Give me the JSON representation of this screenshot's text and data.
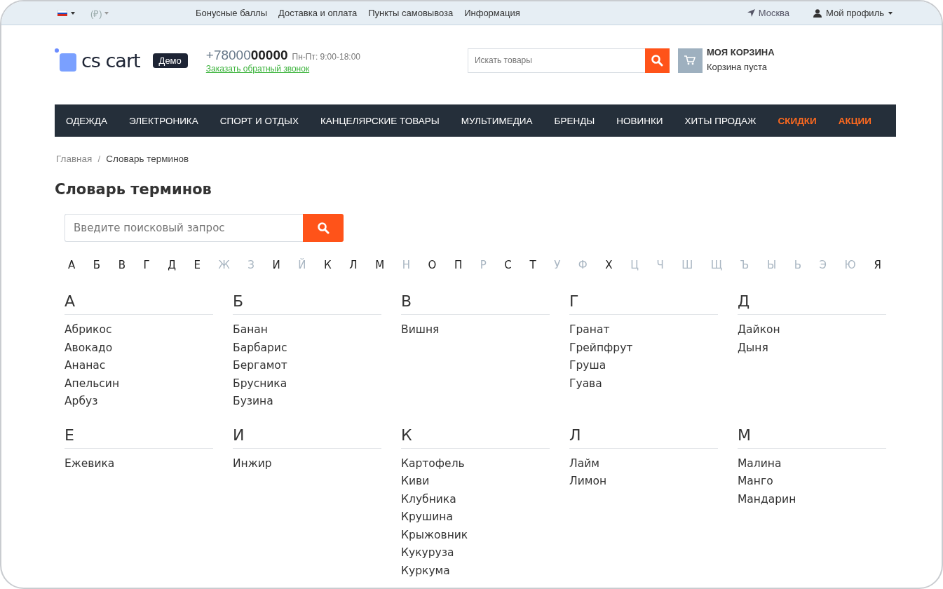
{
  "top_bar": {
    "language_flag": true,
    "currency": "(₽)",
    "links": [
      "Бонусные баллы",
      "Доставка и оплата",
      "Пункты самовывоза",
      "Информация"
    ],
    "city": "Москва",
    "profile": "Мой профиль"
  },
  "header": {
    "logo": "cs cart",
    "badge": "Демо",
    "phone": "+78000**00000**",
    "hours": "Пн-Пт: 9:00-18:00",
    "callback": "Заказать обратный звонок",
    "search": {
      "placeholder": "Искать товары"
    },
    "cart": {
      "title": "МОЯ КОРЗИНА",
      "status": "Корзина пуста"
    }
  },
  "menu": [
    {
      "label": "ОДЕЖДА",
      "highlight": false
    },
    {
      "label": "ЭЛЕКТРОНИКА",
      "highlight": false
    },
    {
      "label": "СПОРТ И ОТДЫХ",
      "highlight": false
    },
    {
      "label": "КАНЦЕЛЯРСКИЕ ТОВАРЫ",
      "highlight": false
    },
    {
      "label": "МУЛЬТИМЕДИА",
      "highlight": false
    },
    {
      "label": "БРЕНДЫ",
      "highlight": false
    },
    {
      "label": "НОВИНКИ",
      "highlight": false
    },
    {
      "label": "ХИТЫ ПРОДАЖ",
      "highlight": false
    },
    {
      "label": "СКИДКИ",
      "highlight": true
    },
    {
      "label": "АКЦИИ",
      "highlight": true
    }
  ],
  "breadcrumbs": [
    "Главная",
    "Словарь терминов"
  ],
  "breadcrumb_separator": "/",
  "page_title": "Словарь терминов",
  "glossary_search": {
    "placeholder": "Введите поисковый запрос"
  },
  "alphabet": [
    {
      "letter": "А",
      "disabled": false
    },
    {
      "letter": "Б",
      "disabled": false
    },
    {
      "letter": "В",
      "disabled": false
    },
    {
      "letter": "Г",
      "disabled": false
    },
    {
      "letter": "Д",
      "disabled": false
    },
    {
      "letter": "Е",
      "disabled": false
    },
    {
      "letter": "Ж",
      "disabled": true
    },
    {
      "letter": "З",
      "disabled": true
    },
    {
      "letter": "И",
      "disabled": false
    },
    {
      "letter": "Й",
      "disabled": true
    },
    {
      "letter": "К",
      "disabled": false
    },
    {
      "letter": "Л",
      "disabled": false
    },
    {
      "letter": "М",
      "disabled": false
    },
    {
      "letter": "Н",
      "disabled": true
    },
    {
      "letter": "О",
      "disabled": false
    },
    {
      "letter": "П",
      "disabled": false
    },
    {
      "letter": "Р",
      "disabled": true
    },
    {
      "letter": "С",
      "disabled": false
    },
    {
      "letter": "Т",
      "disabled": false
    },
    {
      "letter": "У",
      "disabled": true
    },
    {
      "letter": "Ф",
      "disabled": true
    },
    {
      "letter": "Х",
      "disabled": false
    },
    {
      "letter": "Ц",
      "disabled": true
    },
    {
      "letter": "Ч",
      "disabled": true
    },
    {
      "letter": "Ш",
      "disabled": true
    },
    {
      "letter": "Щ",
      "disabled": true
    },
    {
      "letter": "Ъ",
      "disabled": true
    },
    {
      "letter": "Ы",
      "disabled": true
    },
    {
      "letter": "Ь",
      "disabled": true
    },
    {
      "letter": "Э",
      "disabled": true
    },
    {
      "letter": "Ю",
      "disabled": true
    },
    {
      "letter": "Я",
      "disabled": false
    }
  ],
  "groups": [
    {
      "letter": "А",
      "terms": [
        "Абрикос",
        "Авокадо",
        "Ананас",
        "Апельсин",
        "Арбуз"
      ]
    },
    {
      "letter": "Б",
      "terms": [
        "Банан",
        "Барбарис",
        "Бергамот",
        "Брусника",
        "Бузина"
      ]
    },
    {
      "letter": "В",
      "terms": [
        "Вишня"
      ]
    },
    {
      "letter": "Г",
      "terms": [
        "Гранат",
        "Грейпфрут",
        "Груша",
        "Гуава"
      ]
    },
    {
      "letter": "Д",
      "terms": [
        "Дайкон",
        "Дыня"
      ]
    },
    {
      "letter": "Е",
      "terms": [
        "Ежевика"
      ]
    },
    {
      "letter": "И",
      "terms": [
        "Инжир"
      ]
    },
    {
      "letter": "К",
      "terms": [
        "Картофель",
        "Киви",
        "Клубника",
        "Крушина",
        "Крыжовник",
        "Кукуруза",
        "Куркума"
      ]
    },
    {
      "letter": "Л",
      "terms": [
        "Лайм",
        "Лимон"
      ]
    },
    {
      "letter": "М",
      "terms": [
        "Малина",
        "Манго",
        "Мандарин"
      ]
    }
  ]
}
